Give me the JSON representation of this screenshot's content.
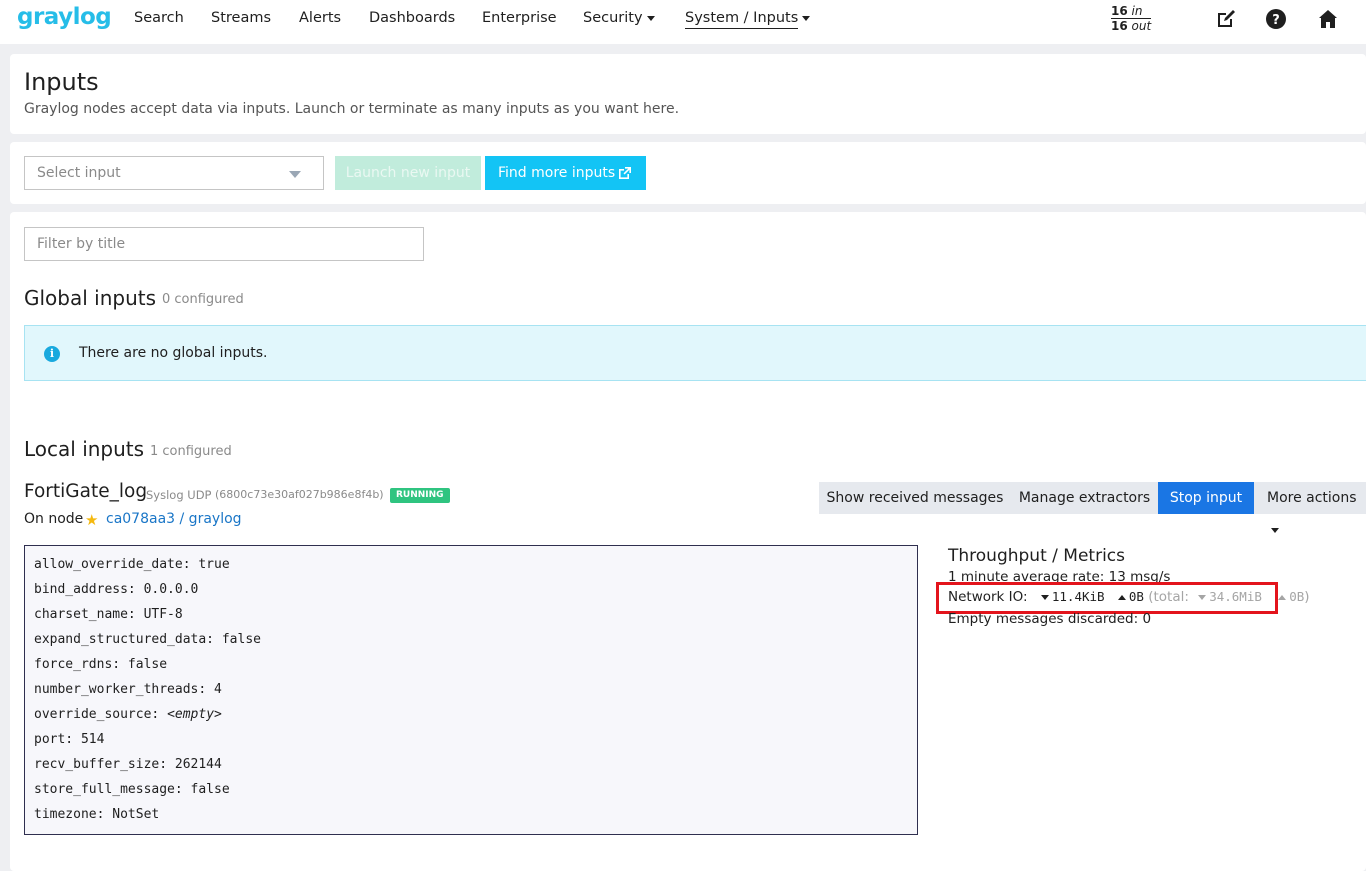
{
  "nav": {
    "logo": "graylog",
    "items": [
      "Search",
      "Streams",
      "Alerts",
      "Dashboards",
      "Enterprise"
    ],
    "security": "Security",
    "system_inputs": "System / Inputs",
    "throughput": {
      "in_count": "16",
      "in_label": "in",
      "out_count": "16",
      "out_label": "out"
    },
    "icons": [
      "edit-icon",
      "help-icon",
      "home-icon"
    ]
  },
  "header": {
    "title": "Inputs",
    "description": "Graylog nodes accept data via inputs. Launch or terminate as many inputs as you want here."
  },
  "launch": {
    "select_placeholder": "Select input",
    "launch_label": "Launch new input",
    "find_label": "Find more inputs"
  },
  "filter": {
    "placeholder": "Filter by title"
  },
  "global_inputs": {
    "title": "Global inputs",
    "count": "0 configured",
    "empty_message": "There are no global inputs."
  },
  "local_inputs": {
    "title": "Local inputs",
    "count": "1 configured"
  },
  "input": {
    "name": "FortiGate_log",
    "type": "Syslog UDP",
    "id": "(6800c73e30af027b986e8f4b)",
    "status": "RUNNING",
    "on_node_label": "On node",
    "node": "ca078aa3 / graylog",
    "buttons": {
      "show_messages": "Show received messages",
      "manage_extractors": "Manage extractors",
      "stop_input": "Stop input",
      "more_actions": "More actions"
    },
    "config": [
      "allow_override_date: true",
      "bind_address: 0.0.0.0",
      "charset_name: UTF-8",
      "expand_structured_data: false",
      "force_rdns: false",
      "number_worker_threads: 4",
      "override_source: ",
      "port: 514",
      "recv_buffer_size: 262144",
      "store_full_message: false",
      "timezone: NotSet"
    ],
    "config_empty_value": "<empty>",
    "metrics": {
      "title": "Throughput / Metrics",
      "avg_rate": "1 minute average rate: 13 msg/s",
      "network_io_label": "Network IO:",
      "rx": "11.4KiB",
      "tx": "0B",
      "total_label": "(total:",
      "total_rx": "34.6MiB",
      "total_tx": "0B",
      "total_close": ")",
      "empty_discarded": "Empty messages discarded: 0"
    }
  },
  "colors": {
    "brand": "#26bde8",
    "find_button": "#13c4f5",
    "stop_button": "#1a76e4",
    "running_badge": "#2fc480",
    "highlight": "#e3141c"
  }
}
